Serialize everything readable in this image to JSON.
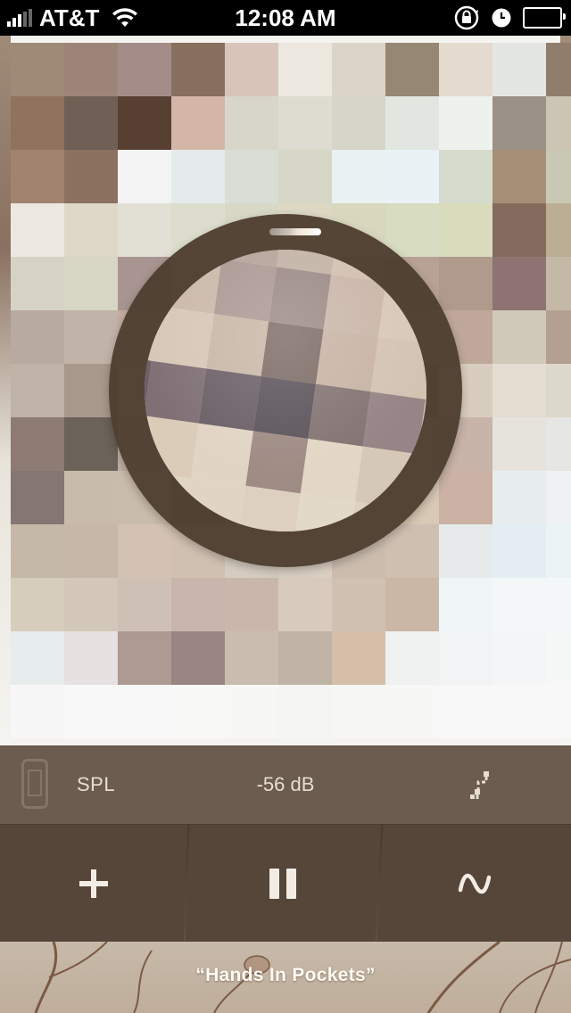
{
  "status_bar": {
    "carrier": "AT&T",
    "time": "12:08 AM"
  },
  "info_bar": {
    "label": "SPL",
    "value": "-56 dB"
  },
  "now_playing": {
    "title": "“Hands In Pockets”"
  },
  "icons": {
    "device": "phone-outline-icon",
    "route": "route-path-icon",
    "add": "plus-icon",
    "pause": "pause-icon",
    "wave": "sine-wave-icon",
    "orientation_lock": "rotation-lock-icon",
    "alarm": "clock-icon",
    "battery": "battery-icon"
  },
  "colors": {
    "ring": "#4e3e30",
    "info_bar": "#6b5c4f",
    "control_bar": "#554639",
    "text": "#e7ddd2"
  },
  "viewfinder": {
    "grid_colors": [
      [
        "#9e8a77",
        "#9c8577",
        "#a48d88",
        "#876f60",
        "#d8c4b8",
        "#ece8e0",
        "#dcd4c8",
        "#968674",
        "#e5dace",
        "#e4e6e2",
        "#917d6c"
      ],
      [
        "#8f735e",
        "#6f5f54",
        "#573f32",
        "#d4b6a8",
        "#d8d6cb",
        "#dedbd0",
        "#d7d4c9",
        "#e2e6e0",
        "#eef2ee",
        "#9c9188",
        "#ccc5b4"
      ],
      [
        "#a08470",
        "#8c7060",
        "#f2f3f2",
        "#e4ebea",
        "#d9ddd5",
        "#d6d7c6",
        "#e9f1f3",
        "#e9f2f5",
        "#d7dbce",
        "#a58f76",
        "#c8c8b4"
      ],
      [
        "#ece8e0",
        "#dfd8c8",
        "#e2e0d4",
        "#ddddce",
        "#d8d8c6",
        "#dcd8c3",
        "#d9d7bd",
        "#d8dcc0",
        "#d8dbbc",
        "#846b5e",
        "#bcae95"
      ],
      [
        "#d6d3c4",
        "#d8d6c5",
        "#a89490",
        "#cbbdb0",
        "#c9bcad",
        "#d5c7b5",
        "#c9b7a4",
        "#b8a296",
        "#af9a8c",
        "#8d7372",
        "#c4b9a6"
      ],
      [
        "#b8aaa0",
        "#c2b3a8",
        "#c4aea0",
        "#c9b3a4",
        "#7e6a62",
        "#d6c8b8",
        "#d7c7b5",
        "#c9b3a0",
        "#bfa89a",
        "#d0c8b8",
        "#b4a090"
      ],
      [
        "#bfb2a6",
        "#a8988b",
        "#d2c3b4",
        "#6f5b55",
        "#8a776f",
        "#6b5c5d",
        "#867472",
        "#978584",
        "#d8cdbf",
        "#e5ddd2",
        "#ddd8cc"
      ],
      [
        "#8e7b74",
        "#6b6259",
        "#bfb0a2",
        "#b49f97",
        "#c9b2a5",
        "#d9c7b5",
        "#ddd0c0",
        "#d6c9bb",
        "#c9b4a9",
        "#e5e3dc",
        "#e6e7e4"
      ],
      [
        "#847673",
        "#c8bba9",
        "#cabcab",
        "#9c8b83",
        "#d7cabc",
        "#e4d8c8",
        "#d8cdbb",
        "#d8c8b5",
        "#cbb2a5",
        "#e8eeef",
        "#eef2f3"
      ],
      [
        "#c6b8a8",
        "#c7b7a6",
        "#d3c2b3",
        "#d0c0b0",
        "#d6cdc0",
        "#dacfc2",
        "#cbbcae",
        "#cfbfb1",
        "#e6eaea",
        "#e4eef2",
        "#ecf3f5"
      ],
      [
        "#d6cdbc",
        "#d2c7b8",
        "#cfc0b5",
        "#c8b6ac",
        "#c8b7aa",
        "#d8cbbd",
        "#d0c1b2",
        "#cab7a6",
        "#eff5f7",
        "#f4f7f8",
        "#f4f7f8"
      ],
      [
        "#e7ecec",
        "#e6e1e0",
        "#ae9a92",
        "#9a8584",
        "#c9bdb0",
        "#bfb3a6",
        "#d6bfa8",
        "#f0f1f1",
        "#f2f3f4",
        "#f4f5f6",
        "#f6f7f7"
      ],
      [
        "#f7f7f7",
        "#f8f8f8",
        "#f8f8f8",
        "#f8f8f7",
        "#f7f7f6",
        "#f5f5f4",
        "#f6f6f5",
        "#f7f7f6",
        "#f8f8f8",
        "#f8f8f8",
        "#f8f8f8"
      ]
    ],
    "lens_colors": [
      [
        "#c9b8a6",
        "#d3c3b2",
        "#b5a39a",
        "#c2b2a5",
        "#d2c0b0",
        "#d8c9b7",
        "#d4c6b6"
      ],
      [
        "#d1c1b0",
        "#cbb9a9",
        "#ab9893",
        "#9c8a86",
        "#c9b6a8",
        "#d8c8b8",
        "#d6c8b7"
      ],
      [
        "#d5c6b6",
        "#d7c7b7",
        "#c9b7a6",
        "#7d6b66",
        "#c7b3a4",
        "#d4c3b2",
        "#d9cbba"
      ],
      [
        "#6d6066",
        "#807076",
        "#6b6066",
        "#5d545c",
        "#837472",
        "#968486",
        "#cdbdb0"
      ],
      [
        "#d8ccbd",
        "#dbcbb9",
        "#e1d4c4",
        "#9e8b84",
        "#e2d6c4",
        "#d6c8b7",
        "#dbcfbf"
      ],
      [
        "#ddd2c2",
        "#e1d5c4",
        "#e0d5c5",
        "#ddd0bf",
        "#e3d9c8",
        "#ddd2c0",
        "#d8ccbb"
      ],
      [
        "#d2c6b6",
        "#d8ccbc",
        "#dbd0bf",
        "#d4c8b8",
        "#dacfbe",
        "#d2c6b5",
        "#cfc2b2"
      ]
    ]
  }
}
